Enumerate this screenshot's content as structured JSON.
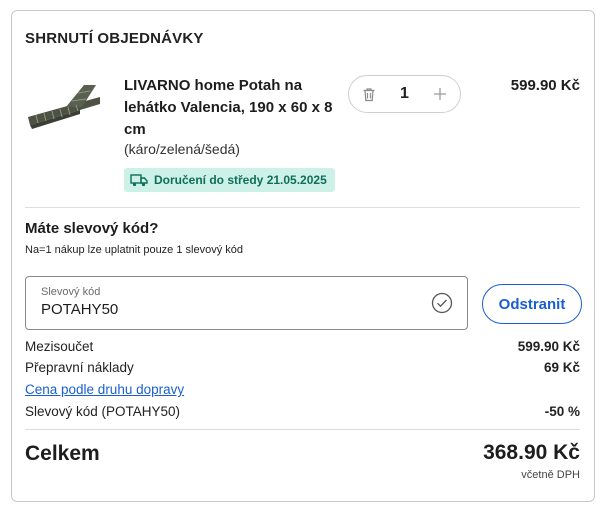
{
  "summary": {
    "title": "SHRNUTÍ OBJEDNÁVKY"
  },
  "product": {
    "name": "LIVARNO home Potah na lehátko Valencia, 190 x 60 x 8 cm",
    "variant": "(káro/zelená/šedá)",
    "delivery": "Doručení do středy 21.05.2025",
    "quantity": "1",
    "price": "599.90 Kč",
    "image_icon": "lounger-cushion-image",
    "delete_icon": "trash-icon",
    "add_icon": "plus-icon"
  },
  "discount": {
    "title": "Máte slevový kód?",
    "note": "Na=1 nákup lze uplatnit pouze 1 slevový kód",
    "field_label": "Slevový kód",
    "field_value": "POTAHY50",
    "remove_label": "Odstranit"
  },
  "totals": {
    "subtotal_label": "Mezisoučet",
    "subtotal_value": "599.90 Kč",
    "shipping_label": "Přepravní náklady",
    "shipping_value": "69 Kč",
    "shipping_link": "Cena podle druhu dopravy",
    "discount_label": "Slevový kód (POTAHY50)",
    "discount_value": "-50 %",
    "total_label": "Celkem",
    "total_value": "368.90 Kč",
    "vat_note": "včetně DPH"
  },
  "colors": {
    "accent": "#1a5fd0",
    "delivery_bg": "#cdf1e7",
    "delivery_text": "#0f6e5a",
    "border": "#c9c9c9"
  }
}
